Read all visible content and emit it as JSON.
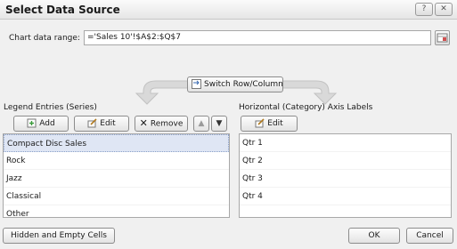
{
  "window": {
    "title": "Select Data Source"
  },
  "chart_range": {
    "label": "Chart data range:",
    "value": "='Sales 10'!$A$2:$Q$7"
  },
  "buttons": {
    "switch": "Switch Row/Column",
    "add": "Add",
    "edit": "Edit",
    "remove": "Remove",
    "edit_axis": "Edit",
    "hidden_empty": "Hidden and Empty Cells",
    "ok": "OK",
    "cancel": "Cancel"
  },
  "legend": {
    "label": "Legend Entries (Series)",
    "items": [
      "Compact Disc Sales",
      "Rock",
      "Jazz",
      "Classical",
      "Other"
    ]
  },
  "axis": {
    "label": "Horizontal (Category) Axis Labels",
    "items": [
      "Qtr 1",
      "Qtr 2",
      "Qtr 3",
      "Qtr 4"
    ]
  },
  "colors": {
    "selection": "#dfe6f4",
    "arrow": "#d7d7d7"
  }
}
